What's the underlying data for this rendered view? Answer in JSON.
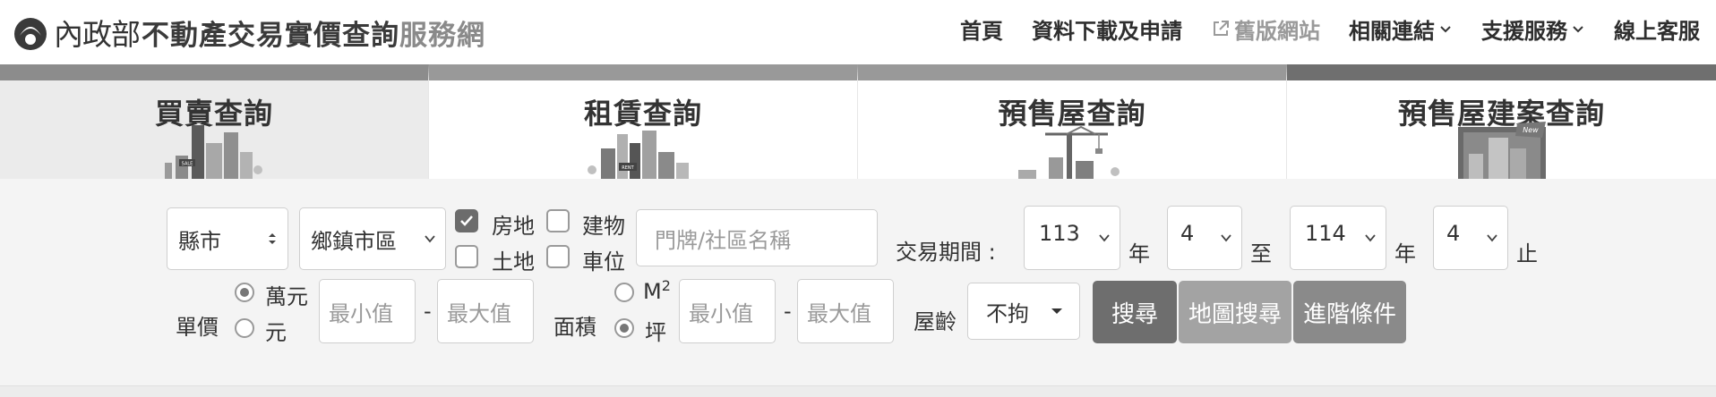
{
  "header": {
    "ministry": "內政部",
    "title": "不動產交易實價查詢",
    "title_suffix": "服務網",
    "nav": {
      "home": "首頁",
      "download": "資料下載及申請",
      "old_site": "舊版網站",
      "links": "相關連結",
      "support": "支援服務",
      "online_service": "線上客服"
    }
  },
  "tabs": {
    "sale": "買賣查詢",
    "rent": "租賃查詢",
    "presale": "預售屋查詢",
    "presale_project": "預售屋建案查詢",
    "art_labels": {
      "sale": "SALE",
      "rent": "RENT",
      "new": "New"
    }
  },
  "search": {
    "county": "縣市",
    "district": "鄉鎮市區",
    "type_house_land": "房地",
    "type_building": "建物",
    "type_land": "土地",
    "type_parking": "車位",
    "address_placeholder": "門牌/社區名稱",
    "period_label": "交易期間",
    "colon": ":",
    "from_year": "113",
    "year_unit": "年",
    "from_month": "4",
    "to_label": "至",
    "to_year": "114",
    "to_month": "4",
    "end_label": "止",
    "unit_price_label": "單價",
    "unit_wan": "萬元",
    "unit_yuan": "元",
    "min_placeholder": "最小值",
    "max_placeholder": "最大值",
    "dash": "-",
    "area_label": "面積",
    "area_m2": "M",
    "area_m2_sup": "2",
    "area_ping": "坪",
    "age_label": "屋齡",
    "age_value": "不拘",
    "search_button": "搜尋",
    "map_search_button": "地圖搜尋",
    "advanced_button": "進階條件"
  },
  "colors": {
    "search_button": "#6e6e6e",
    "map_button": "#a3a3a3",
    "advanced_button": "#8a8a8a"
  }
}
